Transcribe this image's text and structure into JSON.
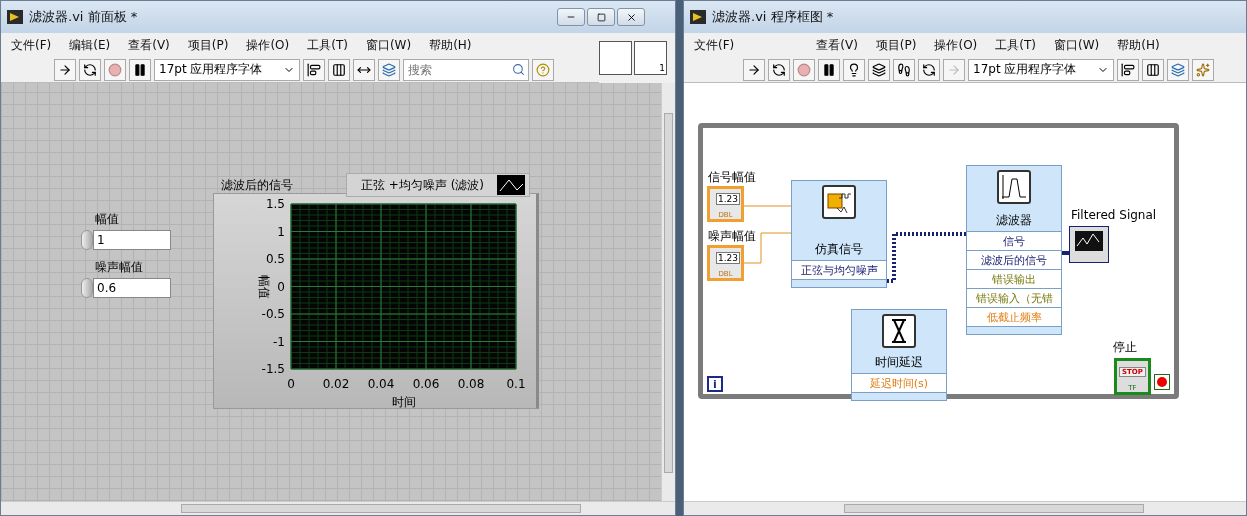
{
  "front_panel": {
    "title": "滤波器.vi 前面板 *",
    "menu": [
      "文件(F)",
      "编辑(E)",
      "查看(V)",
      "项目(P)",
      "操作(O)",
      "工具(T)",
      "窗口(W)",
      "帮助(H)"
    ],
    "toolbar": {
      "font": "17pt 应用程序字体",
      "search": {
        "placeholder": "搜索"
      }
    },
    "connector_pane_number": "1",
    "controls": [
      {
        "label": "幅值",
        "value": "1"
      },
      {
        "label": "噪声幅值",
        "value": "0.6"
      }
    ],
    "graph": {
      "label": "滤波后的信号",
      "chart_data": {
        "type": "line",
        "xlabel": "时间",
        "ylabel": "幅值",
        "categories": [
          "0",
          "0.02",
          "0.04",
          "0.06",
          "0.08",
          "0.1"
        ],
        "ylim": [
          -1.5,
          1.5
        ],
        "yticks": [
          {
            "value": 1.5,
            "label": "1.5"
          },
          {
            "value": 1,
            "label": "1"
          },
          {
            "value": 0.5,
            "label": "0.5"
          },
          {
            "value": 0,
            "label": "0"
          },
          {
            "value": -0.5,
            "label": "-0.5"
          },
          {
            "value": -1,
            "label": "-1"
          },
          {
            "value": -1.5,
            "label": "-1.5"
          }
        ],
        "grid": true,
        "series": [
          {
            "name": "正弦 +均匀噪声 (滤波)",
            "color": "#ffffff",
            "values": [
              null,
              null,
              null,
              null,
              null,
              null
            ]
          }
        ]
      }
    }
  },
  "block_diagram": {
    "title": "滤波器.vi 程序框图 *",
    "menu": [
      "文件(F)",
      "查看(V)",
      "项目(P)",
      "操作(O)",
      "工具(T)",
      "窗口(W)",
      "帮助(H)"
    ],
    "toolbar": {
      "font": "17pt 应用程序字体"
    },
    "terminals": [
      {
        "label": "信号幅值",
        "reading": "1.23",
        "type": "DBL"
      },
      {
        "label": "噪声幅值",
        "reading": "1.23",
        "type": "DBL"
      }
    ],
    "nodes": [
      {
        "title": "仿真信号",
        "kind": "simulate",
        "rows": [
          {
            "label": "正弦与均匀噪声",
            "kind": "signal"
          }
        ]
      },
      {
        "title": "滤波器",
        "kind": "filter",
        "rows": [
          {
            "label": "信号",
            "kind": "signal"
          },
          {
            "label": "滤波后的信号",
            "kind": "signal"
          },
          {
            "label": "错误输出",
            "kind": "error"
          },
          {
            "label": "错误输入（无错",
            "kind": "error"
          },
          {
            "label": "低截止频率",
            "kind": "numeric"
          }
        ]
      },
      {
        "title": "时间延迟",
        "kind": "delay",
        "rows": [
          {
            "label": "延迟时间(s)",
            "kind": "numeric"
          }
        ]
      }
    ],
    "indicator": {
      "label": "Filtered Signal"
    },
    "stop": {
      "label": "停止",
      "text": "STOP",
      "type": "TF"
    },
    "loop_index": "i"
  }
}
